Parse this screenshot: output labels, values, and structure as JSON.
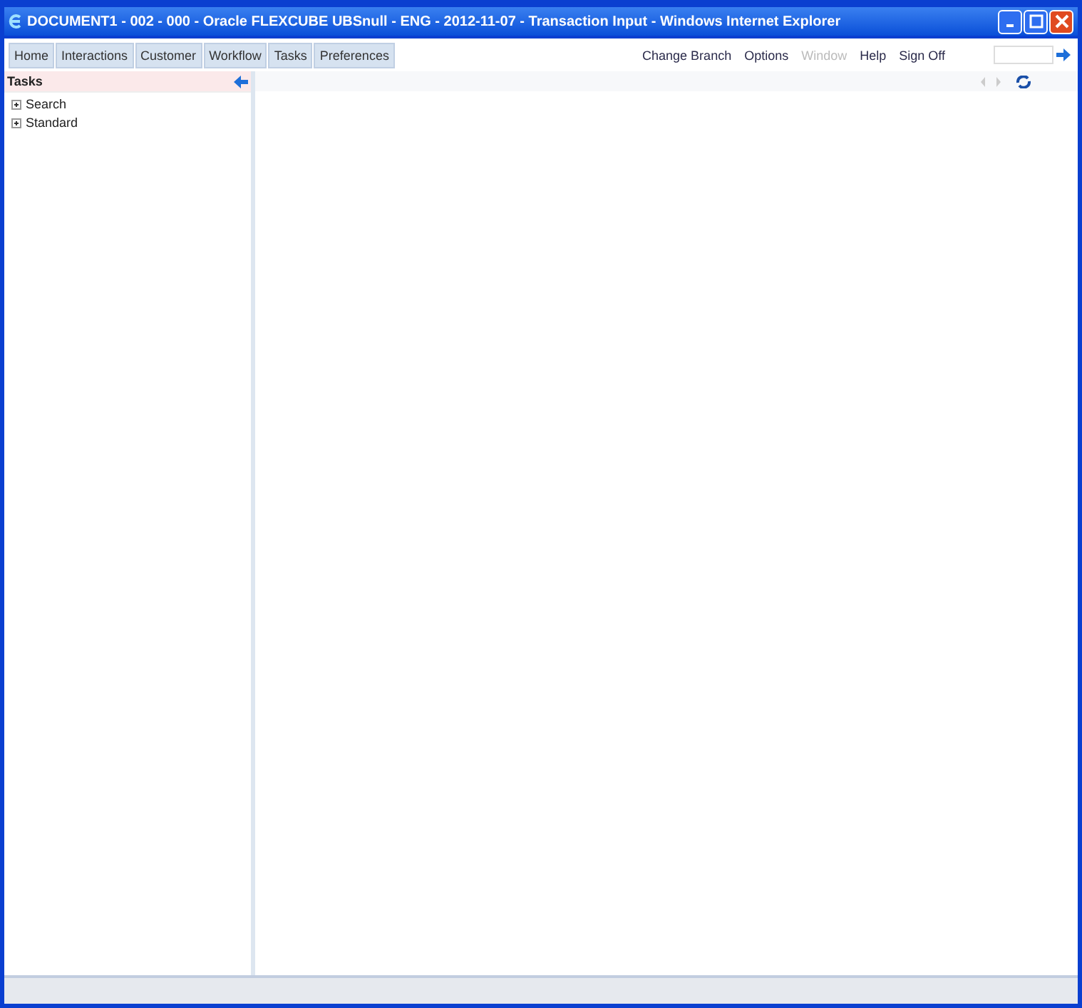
{
  "window": {
    "title": "DOCUMENT1 - 002 - 000 - Oracle FLEXCUBE UBSnull - ENG - 2012-11-07 - Transaction Input - Windows Internet Explorer"
  },
  "tabs": [
    "Home",
    "Interactions",
    "Customer",
    "Workflow",
    "Tasks",
    "Preferences"
  ],
  "top_links": [
    {
      "label": "Change Branch",
      "disabled": false
    },
    {
      "label": "Options",
      "disabled": false
    },
    {
      "label": "Window",
      "disabled": true
    },
    {
      "label": "Help",
      "disabled": false
    },
    {
      "label": "Sign Off",
      "disabled": false
    }
  ],
  "sidebar": {
    "title": "Tasks",
    "items": [
      {
        "label": "Search",
        "expanded": false
      },
      {
        "label": "Standard",
        "expanded": false
      }
    ]
  }
}
